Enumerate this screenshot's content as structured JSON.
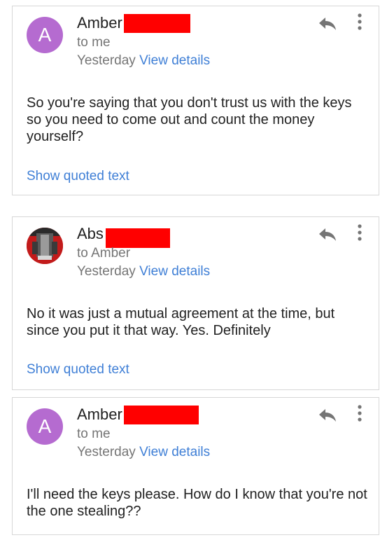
{
  "messages": [
    {
      "avatar_letter": "A",
      "sender": "Amber",
      "recipient": "to me",
      "date": "Yesterday",
      "view_details": "View details",
      "body": "So you're saying that you don't trust us with the keys so you need to come out and count the money yourself?",
      "show_quoted": "Show quoted text"
    },
    {
      "avatar_letter": "",
      "sender": "Abs",
      "recipient": "to Amber",
      "date": "Yesterday",
      "view_details": "View details",
      "body": "No it was just a mutual agreement at the time, but since you put it that way. Yes. Definitely",
      "show_quoted": "Show quoted text"
    },
    {
      "avatar_letter": "A",
      "sender": "Amber",
      "recipient": "to me",
      "date": "Yesterday",
      "view_details": "View details",
      "body": "I'll need the keys please. How do I know that you're not the one stealing??",
      "show_quoted": ""
    }
  ],
  "colors": {
    "avatar_purple": "#b56bd0",
    "link_blue": "#3f7fd6",
    "redaction_red": "#ff0000",
    "secondary_text": "#757575"
  },
  "icons": {
    "reply": "reply-arrow-icon",
    "more": "more-vertical-icon"
  }
}
